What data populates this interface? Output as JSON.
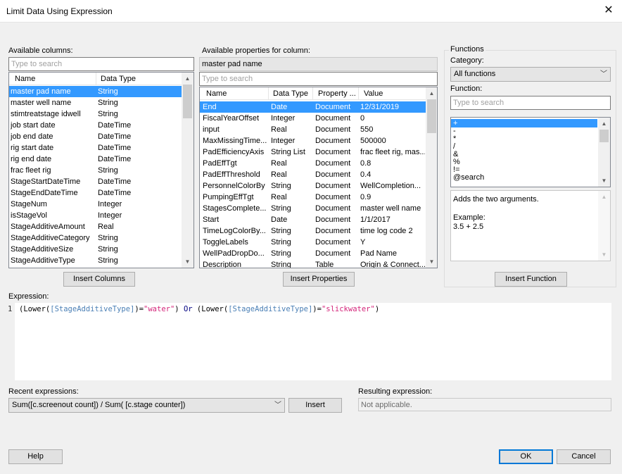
{
  "window": {
    "title": "Limit Data Using Expression",
    "close_glyph": "✕"
  },
  "columns": {
    "label": "Available columns:",
    "search_placeholder": "Type to search",
    "headers": [
      "Name",
      "Data Type"
    ],
    "rows": [
      [
        "master pad name",
        "String"
      ],
      [
        "master well name",
        "String"
      ],
      [
        "stimtreatstage idwell",
        "String"
      ],
      [
        "job start date",
        "DateTime"
      ],
      [
        "job end date",
        "DateTime"
      ],
      [
        "rig start date",
        "DateTime"
      ],
      [
        "rig end date",
        "DateTime"
      ],
      [
        "frac fleet rig",
        "String"
      ],
      [
        "StageStartDateTime",
        "DateTime"
      ],
      [
        "StageEndDateTime",
        "DateTime"
      ],
      [
        "StageNum",
        "Integer"
      ],
      [
        "isStageVol",
        "Integer"
      ],
      [
        "StageAdditiveAmount",
        "Real"
      ],
      [
        "StageAdditiveCategory",
        "String"
      ],
      [
        "StageAdditiveSize",
        "String"
      ],
      [
        "StageAdditiveType",
        "String"
      ]
    ],
    "selected_index": 0,
    "insert_button": "Insert Columns"
  },
  "properties": {
    "label": "Available properties for column:",
    "current_column": "master pad name",
    "search_placeholder": "Type to search",
    "headers": [
      "Name",
      "Data Type",
      "Property ...",
      "Value"
    ],
    "rows": [
      [
        "End",
        "Date",
        "Document",
        "12/31/2019"
      ],
      [
        "FiscalYearOffset",
        "Integer",
        "Document",
        "0"
      ],
      [
        "input",
        "Real",
        "Document",
        "550"
      ],
      [
        "MaxMissingTime...",
        "Integer",
        "Document",
        "500000"
      ],
      [
        "PadEfficiencyAxis",
        "String List",
        "Document",
        "frac fleet rig, mas..."
      ],
      [
        "PadEffTgt",
        "Real",
        "Document",
        "0.8"
      ],
      [
        "PadEffThreshold",
        "Real",
        "Document",
        "0.4"
      ],
      [
        "PersonnelColorBy",
        "String",
        "Document",
        "WellCompletion..."
      ],
      [
        "PumpingEffTgt",
        "Real",
        "Document",
        "0.9"
      ],
      [
        "StagesComplete...",
        "String",
        "Document",
        "master well name"
      ],
      [
        "Start",
        "Date",
        "Document",
        "1/1/2017"
      ],
      [
        "TimeLogColorBy...",
        "String",
        "Document",
        "time log code 2"
      ],
      [
        "ToggleLabels",
        "String",
        "Document",
        "Y"
      ],
      [
        "WellPadDropDo...",
        "String",
        "Document",
        "Pad Name"
      ],
      [
        "Description",
        "String",
        "Table",
        "Origin & Connect..."
      ]
    ],
    "selected_index": 0,
    "insert_button": "Insert Properties"
  },
  "functions": {
    "group_label": "Functions",
    "category_label": "Category:",
    "category_value": "All functions",
    "function_label": "Function:",
    "search_placeholder": "Type to search",
    "items": [
      "+",
      "-",
      "*",
      "/",
      "&",
      "%",
      "!=",
      "@search"
    ],
    "selected_index": 0,
    "description": "Adds the two arguments.",
    "example_label": "Example:",
    "example_value": "3.5 + 2.5",
    "insert_button": "Insert Function"
  },
  "expression": {
    "label": "Expression:",
    "line_number": "1",
    "tokens": [
      {
        "t": "(Lower(",
        "c": "plain"
      },
      {
        "t": "[StageAdditiveType]",
        "c": "col"
      },
      {
        "t": ")=",
        "c": "plain"
      },
      {
        "t": "\"water\"",
        "c": "str"
      },
      {
        "t": ") ",
        "c": "plain"
      },
      {
        "t": "Or",
        "c": "or"
      },
      {
        "t": " (Lower(",
        "c": "plain"
      },
      {
        "t": "[StageAdditiveType]",
        "c": "col"
      },
      {
        "t": ")=",
        "c": "plain"
      },
      {
        "t": "\"slickwater\"",
        "c": "str"
      },
      {
        "t": ")",
        "c": "plain"
      }
    ]
  },
  "recent": {
    "label": "Recent expressions:",
    "value": "Sum([c.screenout count]) / Sum( [c.stage counter])",
    "insert_button": "Insert"
  },
  "result": {
    "label": "Resulting expression:",
    "value": "Not applicable."
  },
  "footer": {
    "help": "Help",
    "ok": "OK",
    "cancel": "Cancel"
  },
  "colors": {
    "selection": "#3399ff",
    "accent": "#0078d7",
    "string": "#d4257a",
    "column": "#4a7fb5"
  }
}
